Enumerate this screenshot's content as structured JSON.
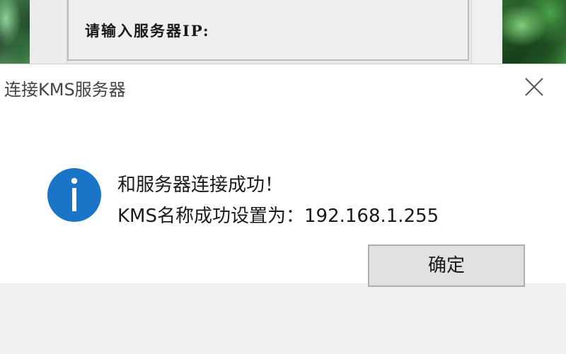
{
  "background_app": {
    "prompt_label": "请输入服务器IP:"
  },
  "dialog": {
    "title": "连接KMS服务器",
    "icon": "info-icon",
    "message_line1": "和服务器连接成功！",
    "message_line2": "KMS名称成功设置为：192.168.1.255",
    "ok_label": "确定",
    "accent_color": "#1a74c8"
  }
}
